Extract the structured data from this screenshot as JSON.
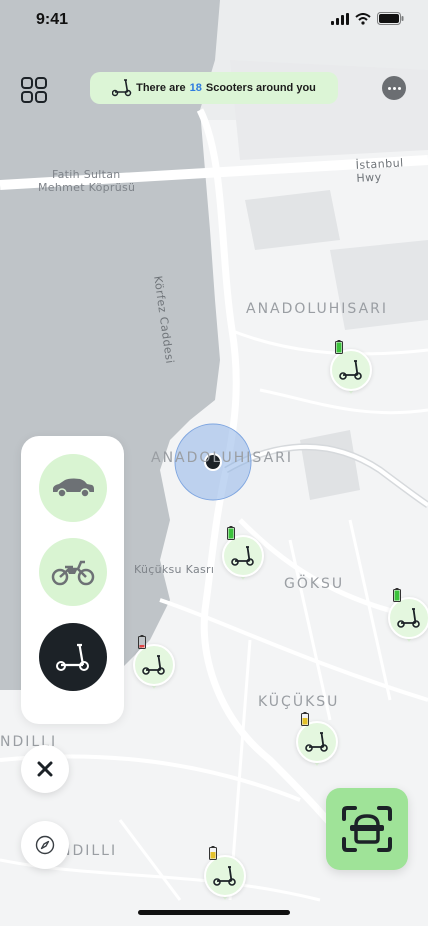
{
  "status": {
    "time": "9:41"
  },
  "banner": {
    "prefix": "There are",
    "count": "18",
    "suffix": "Scooters around you"
  },
  "map_labels": {
    "bridge_line1": "Fatih Sultan",
    "bridge_line2": "Mehmet Köprüsü",
    "highway": "İstanbul Hwy",
    "street": "Körfez Caddesi",
    "district1": "ANADOLUHISARI",
    "district2": "ANADOLUHISARI",
    "place": "Küçüksu Kasrı",
    "district3": "GÖKSU",
    "district4": "KÜÇÜKSU",
    "district5a": "NDILLI",
    "district5b": "NDILLI"
  },
  "vehicles": [
    {
      "name": "car",
      "selected": false
    },
    {
      "name": "motorcycle",
      "selected": false
    },
    {
      "name": "scooter",
      "selected": true
    }
  ],
  "markers": [
    {
      "battery": "full"
    },
    {
      "battery": "full"
    },
    {
      "battery": "full"
    },
    {
      "battery": "low"
    },
    {
      "battery": "medium"
    },
    {
      "battery": "medium"
    }
  ],
  "colors": {
    "accent_green": "#9fe398",
    "light_green": "#dcf5d6",
    "count_blue": "#2d7be0",
    "selected_dark": "#1c2227",
    "location_blue": "#8fb4e8",
    "water": "#bfc4c8"
  }
}
